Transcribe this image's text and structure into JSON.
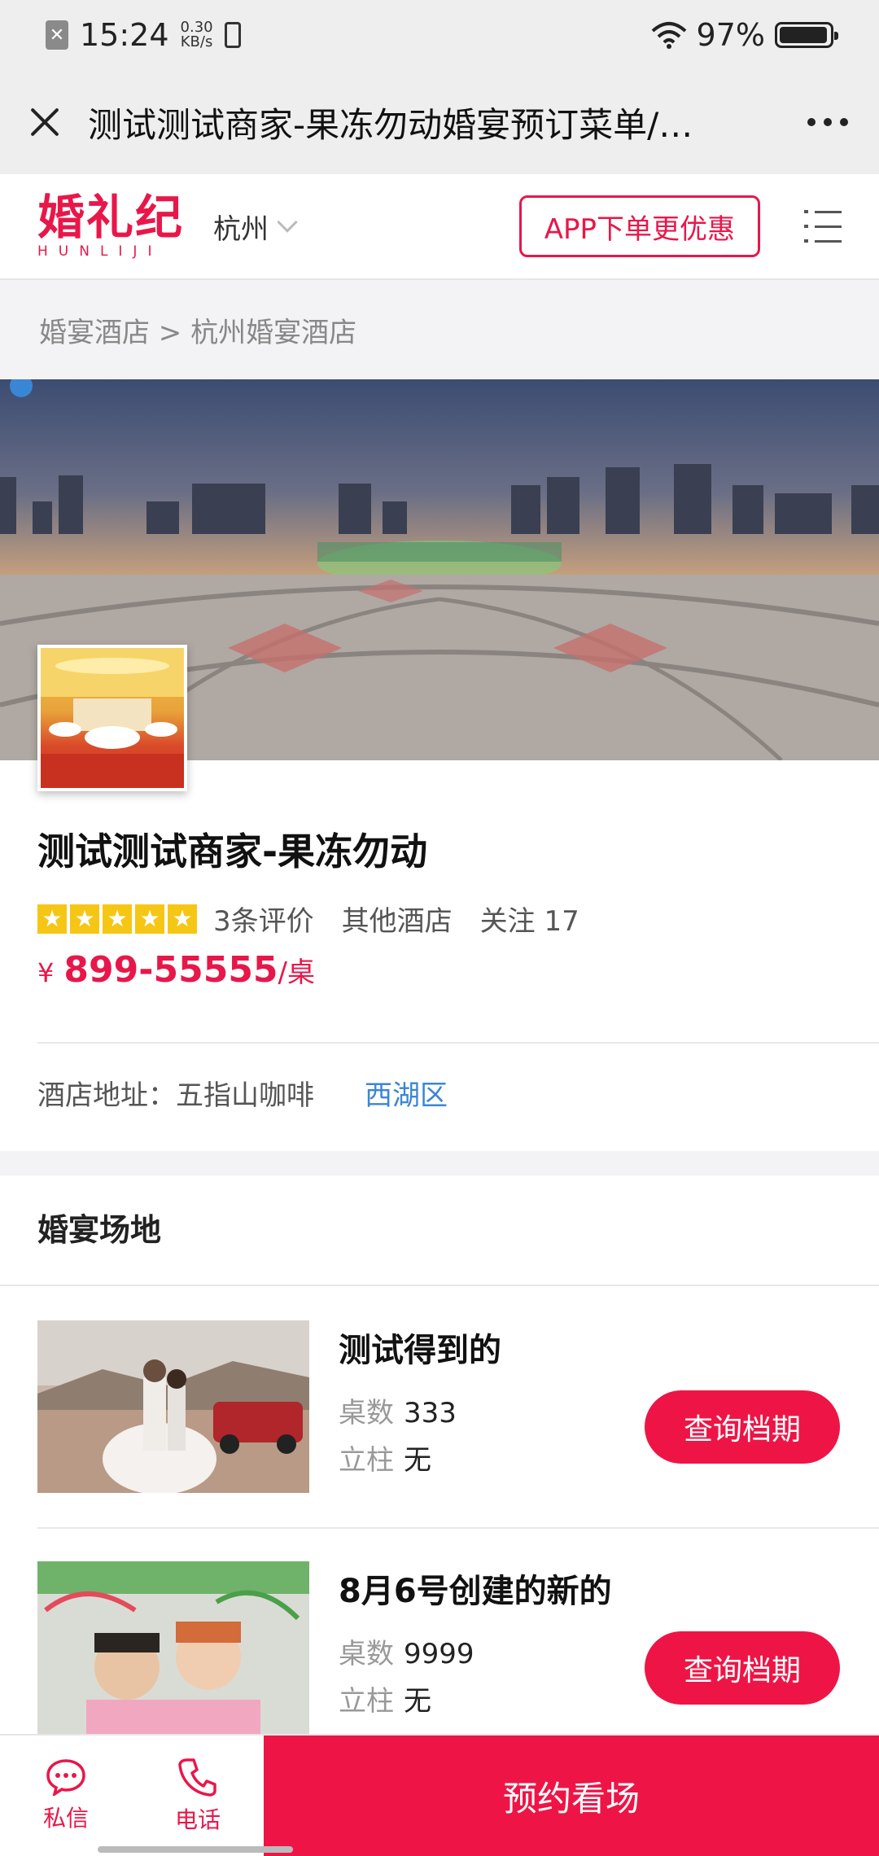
{
  "status_bar": {
    "time": "15:24",
    "speed": "0.30",
    "speed_unit": "KB/s",
    "battery": "97%",
    "battery_level": 0.97
  },
  "title_bar": {
    "title": "测试测试商家-果冻勿动婚宴预订菜单/…"
  },
  "header": {
    "logo": "婚礼纪",
    "logo_sub": "HUNLIJI",
    "city": "杭州",
    "app_button": "APP下单更优惠"
  },
  "breadcrumb": "婚宴酒店 > 杭州婚宴酒店",
  "shop": {
    "name": "测试测试商家-果冻勿动",
    "rating_stars": 5,
    "reviews": "3条评价",
    "category": "其他酒店",
    "follow": "关注 17",
    "price_currency": "¥",
    "price_range": "899-55555",
    "price_unit": "/桌",
    "address_label": "酒店地址：",
    "address": "五指山咖啡",
    "district": "西湖区"
  },
  "section": {
    "title": "婚宴场地"
  },
  "venues": [
    {
      "name": "测试得到的",
      "tables_label": "桌数",
      "tables": "333",
      "pillar_label": "立柱",
      "pillar": "无",
      "button": "查询档期"
    },
    {
      "name": "8月6号创建的新的",
      "tables_label": "桌数",
      "tables": "9999",
      "pillar_label": "立柱",
      "pillar": "无",
      "button": "查询档期"
    }
  ],
  "bottom_bar": {
    "message": "私信",
    "phone": "电话",
    "reserve": "预约看场"
  },
  "colors": {
    "brand": "#e8174a",
    "link": "#3a86d6",
    "star": "#f6c614"
  }
}
